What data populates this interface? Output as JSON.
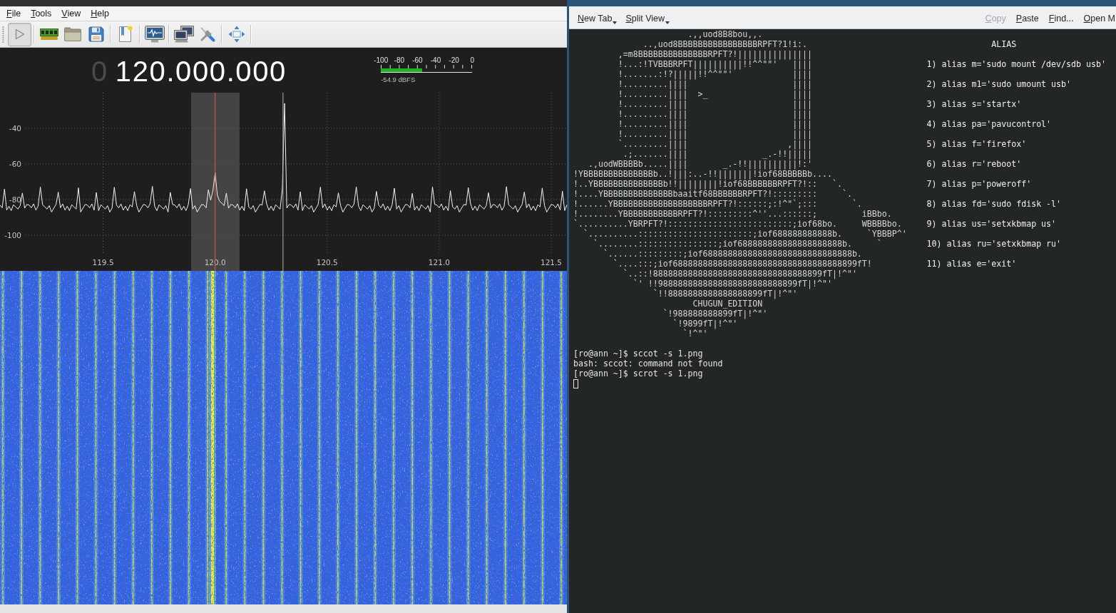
{
  "gqrx": {
    "menu": [
      "File",
      "Tools",
      "View",
      "Help"
    ],
    "toolbar": [
      {
        "kind": "toggle",
        "checked": true
      },
      {
        "kind": "separator"
      },
      {
        "kind": "button"
      },
      {
        "kind": "button"
      },
      {
        "kind": "button"
      },
      {
        "kind": "separator"
      },
      {
        "kind": "button"
      },
      {
        "kind": "separator"
      },
      {
        "kind": "button"
      },
      {
        "kind": "separator"
      },
      {
        "kind": "button"
      },
      {
        "kind": "button"
      },
      {
        "kind": "separator"
      },
      {
        "kind": "button"
      },
      {
        "kind": "separator"
      }
    ],
    "frequency": {
      "leading": "0",
      "value": "120.000.000"
    },
    "meter": {
      "scale": [
        "-100",
        "-80",
        "-60",
        "-40",
        "-20",
        "0"
      ],
      "level": 0.45,
      "reading": "-54.9 dBFS"
    },
    "spectrum": {
      "chart_data": {
        "type": "line",
        "xlim": [
          119.04,
          121.57
        ],
        "ylim": [
          -120,
          -20
        ],
        "grid": true,
        "xticks": [
          {
            "value": 119.5,
            "label": "119.5"
          },
          {
            "value": 120,
            "label": "120.0"
          },
          {
            "value": 120.5,
            "label": "120.5"
          },
          {
            "value": 121,
            "label": "121.0"
          },
          {
            "value": 121.5,
            "label": "121.5"
          }
        ],
        "yticks": [
          -40,
          -60,
          -80,
          -100
        ],
        "bands": [
          {
            "axis": "x",
            "from": 119.893,
            "to": 120.109,
            "color": "#454445"
          }
        ],
        "ref_lines": [
          {
            "axis": "x",
            "value": 120.303,
            "color": "#b4b4b4"
          },
          {
            "axis": "x",
            "value": 120,
            "color": "#e05a5a"
          }
        ],
        "x": [
          119.04,
          119.05,
          119.06,
          119.07,
          119.08,
          119.09,
          119.1,
          119.11,
          119.12,
          119.13,
          119.14,
          119.15,
          119.16,
          119.17,
          119.18,
          119.19,
          119.2,
          119.21,
          119.22,
          119.23,
          119.24,
          119.25,
          119.26,
          119.27,
          119.28,
          119.29,
          119.3,
          119.31,
          119.32,
          119.33,
          119.34,
          119.35,
          119.36,
          119.37,
          119.38,
          119.39,
          119.4,
          119.41,
          119.42,
          119.43,
          119.44,
          119.45,
          119.46,
          119.47,
          119.48,
          119.49,
          119.5,
          119.51,
          119.52,
          119.53,
          119.54,
          119.55,
          119.56,
          119.57,
          119.58,
          119.59,
          119.6,
          119.61,
          119.62,
          119.63,
          119.64,
          119.65,
          119.66,
          119.67,
          119.68,
          119.69,
          119.7,
          119.71,
          119.72,
          119.73,
          119.74,
          119.75,
          119.76,
          119.77,
          119.78,
          119.79,
          119.8,
          119.81,
          119.82,
          119.83,
          119.84,
          119.85,
          119.86,
          119.87,
          119.88,
          119.89,
          119.9,
          119.91,
          119.92,
          119.93,
          119.94,
          119.95,
          119.96,
          119.97,
          119.98,
          119.99,
          120.0,
          120.01,
          120.02,
          120.03,
          120.04,
          120.05,
          120.06,
          120.07,
          120.08,
          120.09,
          120.1,
          120.11,
          120.12,
          120.13,
          120.14,
          120.15,
          120.16,
          120.17,
          120.18,
          120.19,
          120.2,
          120.21,
          120.22,
          120.23,
          120.24,
          120.25,
          120.26,
          120.27,
          120.28,
          120.29,
          120.3,
          120.31,
          120.32,
          120.33,
          120.34,
          120.35,
          120.36,
          120.37,
          120.38,
          120.39,
          120.4,
          120.41,
          120.42,
          120.43,
          120.44,
          120.45,
          120.46,
          120.47,
          120.48,
          120.49,
          120.5,
          120.51,
          120.52,
          120.53,
          120.54,
          120.55,
          120.56,
          120.57,
          120.58,
          120.59,
          120.6,
          120.61,
          120.62,
          120.63,
          120.64,
          120.65,
          120.66,
          120.67,
          120.68,
          120.69,
          120.7,
          120.71,
          120.72,
          120.73,
          120.74,
          120.75,
          120.76,
          120.77,
          120.78,
          120.79,
          120.8,
          120.81,
          120.82,
          120.83,
          120.84,
          120.85,
          120.86,
          120.87,
          120.88,
          120.89,
          120.9,
          120.91,
          120.92,
          120.93,
          120.94,
          120.95,
          120.96,
          120.97,
          120.98,
          120.99,
          121.0,
          121.01,
          121.02,
          121.03,
          121.04,
          121.05,
          121.06,
          121.07,
          121.08,
          121.09,
          121.1,
          121.11,
          121.12,
          121.13,
          121.14,
          121.15,
          121.16,
          121.17,
          121.18,
          121.19,
          121.2,
          121.21,
          121.22,
          121.23,
          121.24,
          121.25,
          121.26,
          121.27,
          121.28,
          121.29,
          121.3,
          121.31,
          121.32,
          121.33,
          121.34,
          121.35,
          121.36,
          121.37,
          121.38,
          121.39,
          121.4,
          121.41,
          121.42,
          121.43,
          121.44,
          121.45,
          121.46,
          121.47,
          121.48,
          121.49,
          121.5,
          121.51,
          121.52,
          121.53,
          121.54,
          121.55,
          121.56,
          121.57
        ],
        "series": [
          {
            "color": "#f2f2f2",
            "values": [
              -83.1,
              -84.6,
              -74.1,
              -85.9,
              -83.7,
              -86.2,
              -82.9,
              -84.1,
              -85.3,
              -83.4,
              -76.3,
              -84.8,
              -82.7,
              -83.1,
              -84.6,
              -82.4,
              -85.9,
              -83.7,
              -72.9,
              -82.9,
              -84.1,
              -85.3,
              -83.4,
              -87.0,
              -84.8,
              -82.7,
              -75.8,
              -84.6,
              -82.4,
              -85.9,
              -83.7,
              -86.2,
              -82.9,
              -84.1,
              -85.3,
              -73.4,
              -87.0,
              -84.8,
              -82.7,
              -83.1,
              -84.6,
              -82.4,
              -85.9,
              -76.0,
              -86.2,
              -82.9,
              -84.1,
              -85.3,
              -83.4,
              -87.0,
              -84.8,
              -73.1,
              -83.1,
              -84.6,
              -82.4,
              -85.9,
              -83.7,
              -86.2,
              -82.9,
              -84.1,
              -75.5,
              -83.4,
              -87.0,
              -84.8,
              -82.7,
              -83.1,
              -84.6,
              -82.4,
              -72.6,
              -83.7,
              -86.2,
              -82.9,
              -84.1,
              -85.3,
              -83.4,
              -87.0,
              -75.9,
              -82.7,
              -83.1,
              -84.6,
              -82.4,
              -85.9,
              -83.7,
              -86.2,
              -82.9,
              -73.8,
              -85.3,
              -83.4,
              -87.0,
              -84.8,
              -82.7,
              -83.1,
              -84.6,
              -74.5,
              -80.3,
              -75.2,
              -64.8,
              -77.6,
              -80.9,
              -82.0,
              -83.4,
              -76.4,
              -84.8,
              -82.7,
              -83.1,
              -84.6,
              -82.4,
              -85.9,
              -83.7,
              -86.2,
              -73.9,
              -84.1,
              -85.3,
              -83.4,
              -87.0,
              -84.8,
              -82.7,
              -83.1,
              -75.1,
              -82.4,
              -85.9,
              -83.7,
              -86.2,
              -82.9,
              -84.1,
              -85.3,
              -74.0,
              -26.0,
              -84.8,
              -82.7,
              -83.1,
              -84.6,
              -82.4,
              -85.9,
              -75.6,
              -86.2,
              -82.9,
              -84.1,
              -85.3,
              -83.4,
              -87.0,
              -84.8,
              -82.7,
              -73.0,
              -84.6,
              -82.4,
              -85.9,
              -83.7,
              -86.2,
              -82.9,
              -84.1,
              -76.2,
              -83.4,
              -87.0,
              -84.8,
              -82.7,
              -83.1,
              -84.6,
              -82.4,
              -72.8,
              -83.7,
              -86.2,
              -82.9,
              -84.1,
              -85.3,
              -83.4,
              -87.0,
              -84.8,
              -75.4,
              -83.1,
              -84.6,
              -82.4,
              -85.9,
              -83.7,
              -86.2,
              -82.9,
              -73.6,
              -85.3,
              -83.4,
              -87.0,
              -84.8,
              -82.7,
              -83.1,
              -84.6,
              -76.5,
              -85.9,
              -83.7,
              -86.2,
              -82.9,
              -84.1,
              -85.3,
              -83.4,
              -87.0,
              -72.9,
              -82.7,
              -83.1,
              -84.6,
              -82.4,
              -85.9,
              -83.7,
              -86.2,
              -75.0,
              -84.1,
              -85.3,
              -83.4,
              -87.0,
              -84.8,
              -82.7,
              -83.1,
              -73.3,
              -82.4,
              -85.9,
              -83.7,
              -86.2,
              -82.9,
              -84.1,
              -85.3,
              -83.4,
              -76.1,
              -84.8,
              -82.7,
              -83.1,
              -84.6,
              -82.4,
              -85.9,
              -83.7,
              -72.7,
              -82.9,
              -84.1,
              -85.3,
              -83.4,
              -87.0,
              -84.8,
              -82.7,
              -75.7,
              -84.6,
              -82.4,
              -85.9,
              -83.7,
              -86.2,
              -82.9,
              -84.1,
              -73.5,
              -83.4,
              -87.0,
              -84.8,
              -82.7,
              -83.1,
              -84.6,
              -82.4,
              -85.9,
              -75.3,
              -86.2,
              -82.9
            ]
          }
        ]
      }
    }
  },
  "konsole": {
    "toolbar_left": [
      {
        "label": "New Tab",
        "menu": true,
        "disabled": false
      },
      {
        "label": "Split View",
        "menu": true,
        "disabled": false
      }
    ],
    "toolbar_right": [
      {
        "label": "Copy",
        "menu": false,
        "disabled": true
      },
      {
        "label": "Paste",
        "menu": false,
        "disabled": false
      },
      {
        "label": "Find...",
        "menu": false,
        "disabled": false
      },
      {
        "label": "Open M",
        "menu": false,
        "disabled": false
      }
    ],
    "terminal": {
      "ascii_art": [
        "                       .,,uod8B8bou,,.",
        "              ..,uod8BBBBBBBBBBBBBBBBRPFT?1!i:.",
        "         ,=m8BBBBBBBBBBBBBBRPFT?!|||||||||||||||",
        "         !...:!TVBBBRPFT||||||||||!!^^\"\"'   ||||",
        "         !.......:!?|||||!!^^\"\"'            ||||",
        "         !.........||||                     ||||",
        "         !.........||||  >_                 ||||",
        "         !.........||||                     ||||",
        "         !.........||||                     ||||",
        "         !.........||||                     ||||",
        "         !.........||||                     ||||",
        "         `.........||||                    ,||||",
        "          .;.......||||               _.-!!|||||",
        "   .,uodWBBBBb.....||||       _.-!!||||||||||!:'",
        "!YBBBBBBBBBBBBBBb..!|||:..-!!|||||||!iof68BBBBBb....",
        "!..YBBBBBBBBBBBBBBb!!||||||||!iof68BBBBBBRPFT?!::   `.",
        "!....YBBBBBBBBBBBBBBbaaitf68BBBBBBRPFT?!:::::::::     `.",
        "!......YBBBBBBBBBBBBBBBBBBBRPFT?!::::::;:!^\"`;:::       `.",
        "!........YBBBBBBBBBBBRPFT?!:::::::::^''...::::::;         iBBbo.",
        "`..........YBRPFT?!:::::::::::::::::::::::::;iof68bo.     WBBBBbo.",
        "  `..........:::::::::::::::::::::::;iof688888888888b.     `YBBBP^'",
        "    `........::::::::::::::::;iof688888888888888888888b.     `",
        "      `......:::::::::;iof688888888888888888888888888888b.",
        "        `....:::;iof6888888888888888888888888888888888899fT!",
        "          `..::!8888888888888888888888888888888899fT|!^\"'",
        "            `' !!9888888888888888888888888899fT|!^\"'",
        "                `!!8888888888888888899fT|!^\"'",
        "                        CHUGUN_EDITION",
        "                  `!988888888899fT|!^\"'",
        "                    `!9899fT|!^\"'",
        "                      `!^\"'"
      ],
      "alias_title": "ALIAS",
      "aliases": [
        "1) alias m='sudo mount /dev/sdb usb'",
        "2) alias m1='sudo umount usb'",
        "3) alias s='startx'",
        "4) alias pa='pavucontrol'",
        "5) alias f='firefox'",
        "6) alias r='reboot'",
        "7) alias p='poweroff'",
        "8) alias fd='sudo fdisk -l'",
        "9) alias us='setxkbmap us'",
        "10) alias ru='setxkbmap ru'",
        "11) alias e='exit'"
      ],
      "lines": [
        "[ro@ann ~]$ sccot -s 1.png",
        "bash: sccot: command not found",
        "[ro@ann ~]$ scrot -s 1.png"
      ],
      "cursor_focused": false
    }
  }
}
